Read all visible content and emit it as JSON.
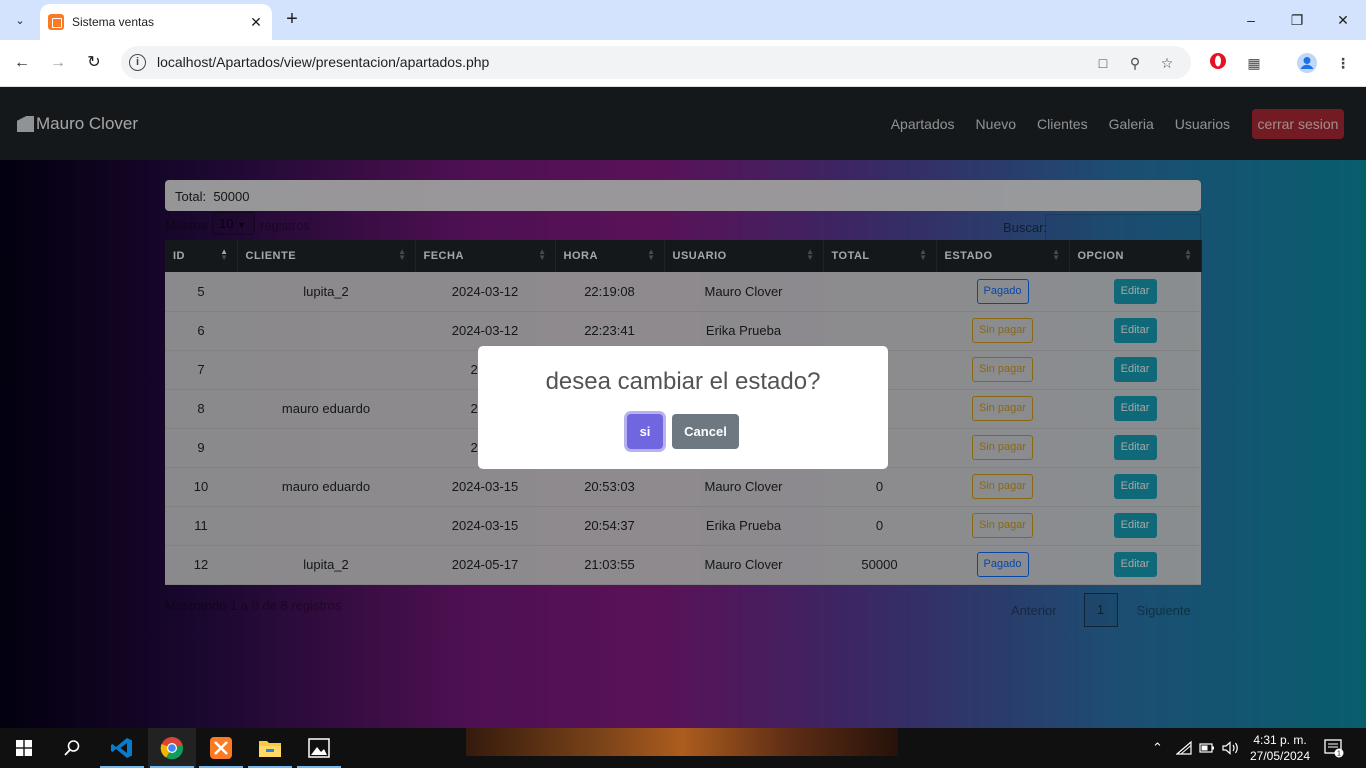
{
  "browser": {
    "tab_title": "Sistema ventas",
    "url": "localhost/Apartados/view/presentacion/apartados.php"
  },
  "navbar": {
    "brand": "Mauro Clover",
    "links": [
      "Apartados",
      "Nuevo",
      "Clientes",
      "Galeria",
      "Usuarios"
    ],
    "logout": "cerrar sesion"
  },
  "summary": {
    "total_label": "Total:",
    "total_value": "50000"
  },
  "table_controls": {
    "length_label": "Mostrar",
    "length_value": "10",
    "length_suffix": "registros",
    "search_label": "Buscar:"
  },
  "table": {
    "columns": [
      "ID",
      "CLIENTE",
      "FECHA",
      "HORA",
      "USUARIO",
      "TOTAL",
      "ESTADO",
      "OPCION"
    ],
    "rows": [
      {
        "id": "5",
        "cliente": "lupita_2",
        "fecha": "2024-03-12",
        "hora": "22:19:08",
        "usuario": "Mauro Clover",
        "total": "",
        "estado": "Pagado",
        "opcion": "Editar"
      },
      {
        "id": "6",
        "cliente": "",
        "fecha": "2024-03-12",
        "hora": "22:23:41",
        "usuario": "Erika Prueba",
        "total": "",
        "estado": "Sin pagar",
        "opcion": "Editar"
      },
      {
        "id": "7",
        "cliente": "",
        "fecha": "2024",
        "hora": "",
        "usuario": "",
        "total": "",
        "estado": "Sin pagar",
        "opcion": "Editar"
      },
      {
        "id": "8",
        "cliente": "mauro eduardo",
        "fecha": "2024",
        "hora": "",
        "usuario": "",
        "total": "",
        "estado": "Sin pagar",
        "opcion": "Editar"
      },
      {
        "id": "9",
        "cliente": "",
        "fecha": "2024",
        "hora": "",
        "usuario": "",
        "total": "",
        "estado": "Sin pagar",
        "opcion": "Editar"
      },
      {
        "id": "10",
        "cliente": "mauro eduardo",
        "fecha": "2024-03-15",
        "hora": "20:53:03",
        "usuario": "Mauro Clover",
        "total": "0",
        "estado": "Sin pagar",
        "opcion": "Editar"
      },
      {
        "id": "11",
        "cliente": "",
        "fecha": "2024-03-15",
        "hora": "20:54:37",
        "usuario": "Erika Prueba",
        "total": "0",
        "estado": "Sin pagar",
        "opcion": "Editar"
      },
      {
        "id": "12",
        "cliente": "lupita_2",
        "fecha": "2024-05-17",
        "hora": "21:03:55",
        "usuario": "Mauro Clover",
        "total": "50000",
        "estado": "Pagado",
        "opcion": "Editar"
      }
    ]
  },
  "table_info": "Mostrando 1 a 8 de 8 registros",
  "pagination": {
    "prev": "Anterior",
    "current": "1",
    "next": "Siguiente"
  },
  "dialog": {
    "title": "desea cambiar el estado?",
    "confirm": "si",
    "cancel": "Cancel"
  },
  "taskbar": {
    "time": "4:31 p. m.",
    "date": "27/05/2024",
    "notifications": "1",
    "apps": [
      "start-icon",
      "search-icon",
      "vscode-icon",
      "chrome-icon",
      "xampp-icon",
      "file-explorer-icon",
      "photos-icon"
    ]
  },
  "colors": {
    "dialog_confirm": "#7066e0",
    "dialog_cancel": "#6e7881",
    "logout": "#b02a37",
    "edit": "#17a2b8",
    "paid": "#0d6efd",
    "unpaid": "#d4a017"
  }
}
